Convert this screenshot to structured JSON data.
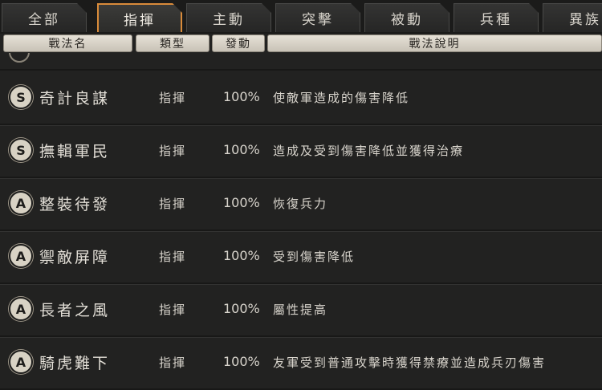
{
  "tabs": [
    {
      "label": "全部",
      "active": false
    },
    {
      "label": "指揮",
      "active": true
    },
    {
      "label": "主動",
      "active": false
    },
    {
      "label": "突擊",
      "active": false
    },
    {
      "label": "被動",
      "active": false
    },
    {
      "label": "兵種",
      "active": false
    },
    {
      "label": "異族",
      "active": false
    }
  ],
  "columns": {
    "name": "戰法名",
    "type": "類型",
    "trigger": "發動",
    "description": "戰法說明"
  },
  "rows": [
    {
      "grade": "S",
      "name": "奇計良謀",
      "type": "指揮",
      "rate": "100%",
      "description": "使敵軍造成的傷害降低"
    },
    {
      "grade": "S",
      "name": "撫輯軍民",
      "type": "指揮",
      "rate": "100%",
      "description": "造成及受到傷害降低並獲得治療"
    },
    {
      "grade": "A",
      "name": "整裝待發",
      "type": "指揮",
      "rate": "100%",
      "description": "恢復兵力"
    },
    {
      "grade": "A",
      "name": "禦敵屏障",
      "type": "指揮",
      "rate": "100%",
      "description": "受到傷害降低"
    },
    {
      "grade": "A",
      "name": "長者之風",
      "type": "指揮",
      "rate": "100%",
      "description": "屬性提高"
    },
    {
      "grade": "A",
      "name": "騎虎難下",
      "type": "指揮",
      "rate": "100%",
      "description": "友軍受到普通攻擊時獲得禁療並造成兵刃傷害"
    }
  ],
  "colors": {
    "accent": "#d98b3a",
    "background": "#222221",
    "header": "#ddd8cd"
  }
}
